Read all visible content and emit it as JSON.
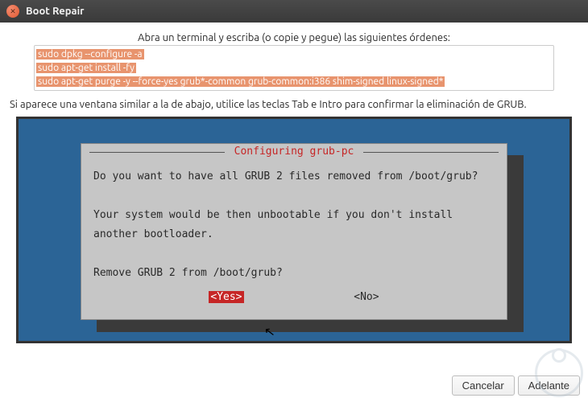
{
  "window": {
    "title": "Boot Repair"
  },
  "instructions": {
    "heading": "Abra un terminal y escriba (o copie y pegue) las siguientes órdenes:",
    "commands": [
      "sudo dpkg --configure -a",
      "sudo apt-get install -fy",
      "sudo apt-get purge -y --force-yes grub*-common grub-common:i386 shim-signed linux-signed*"
    ],
    "note": "Si aparece una ventana similar a la de abajo, utilice las teclas Tab e Intro para confirmar la eliminación de GRUB."
  },
  "tui_dialog": {
    "title": "Configuring grub-pc",
    "line1": "Do you want to have all GRUB 2 files removed from /boot/grub?",
    "line2": "Your system would be then unbootable if you don't install another bootloader.",
    "line3": "Remove GRUB 2 from /boot/grub?",
    "yes_label": "<Yes>",
    "no_label": "<No>",
    "selected": "yes"
  },
  "footer": {
    "cancel_label": "Cancelar",
    "forward_label": "Adelante"
  }
}
